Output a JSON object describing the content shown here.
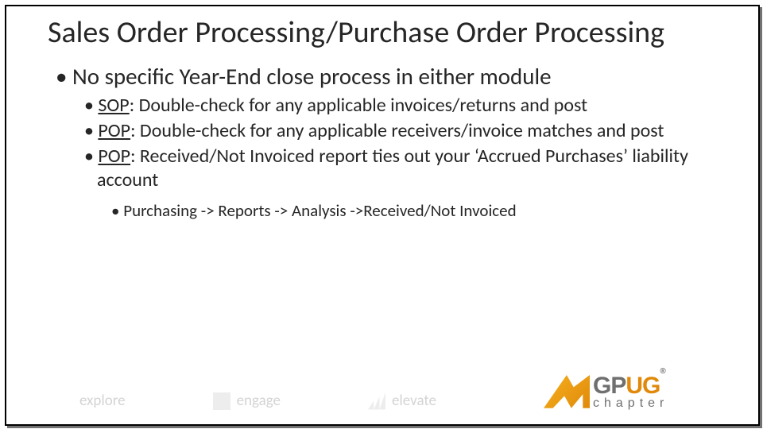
{
  "slide": {
    "title": "Sales Order Processing/Purchase Order Processing",
    "level1": "No specific Year-End close process in either module",
    "level2": [
      {
        "tag": "SOP",
        "text": ":  Double-check for any applicable invoices/returns and post"
      },
      {
        "tag": "POP",
        "text": ":  Double-check for any applicable receivers/invoice matches and post"
      },
      {
        "tag": "POP",
        "text": ":  Received/Not Invoiced report ties out your ‘Accrued Purchases’ liability account"
      }
    ],
    "level3": "Purchasing -> Reports -> Analysis ->Received/Not Invoiced"
  },
  "footer": {
    "words": [
      "explore",
      "engage",
      "elevate"
    ]
  },
  "logo": {
    "gp": "GP",
    "ug": "UG",
    "reg": "®",
    "sub": "chapter"
  }
}
